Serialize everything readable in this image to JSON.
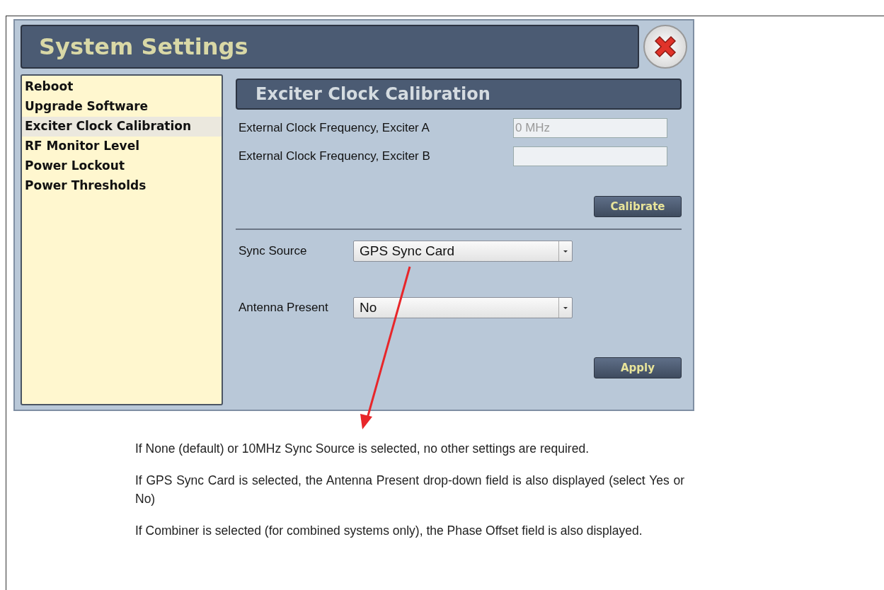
{
  "window": {
    "title": "System Settings"
  },
  "sidebar": {
    "items": [
      {
        "label": "Reboot",
        "selected": false
      },
      {
        "label": "Upgrade Software",
        "selected": false
      },
      {
        "label": "Exciter Clock Calibration",
        "selected": true
      },
      {
        "label": "RF Monitor Level",
        "selected": false
      },
      {
        "label": "Power Lockout",
        "selected": false
      },
      {
        "label": "Power Thresholds",
        "selected": false
      }
    ]
  },
  "panel": {
    "title": "Exciter Clock Calibration",
    "fields": [
      {
        "label": "External Clock Frequency, Exciter A",
        "placeholder": "0 MHz"
      },
      {
        "label": "External Clock Frequency, Exciter B"
      }
    ],
    "calibrate_button": "Calibrate",
    "dropdowns": [
      {
        "label": "Sync Source",
        "value": "GPS Sync Card"
      },
      {
        "label": "Antenna Present",
        "value": "No"
      }
    ],
    "apply_button": "Apply"
  },
  "notes": [
    "If None (default) or 10MHz Sync Source is selected, no other settings are required.",
    "If GPS Sync Card is selected, the Antenna Present drop-down field is also displayed (select Yes or No)",
    "If Combiner is selected (for combined systems only), the Phase Offset field is also displayed."
  ]
}
